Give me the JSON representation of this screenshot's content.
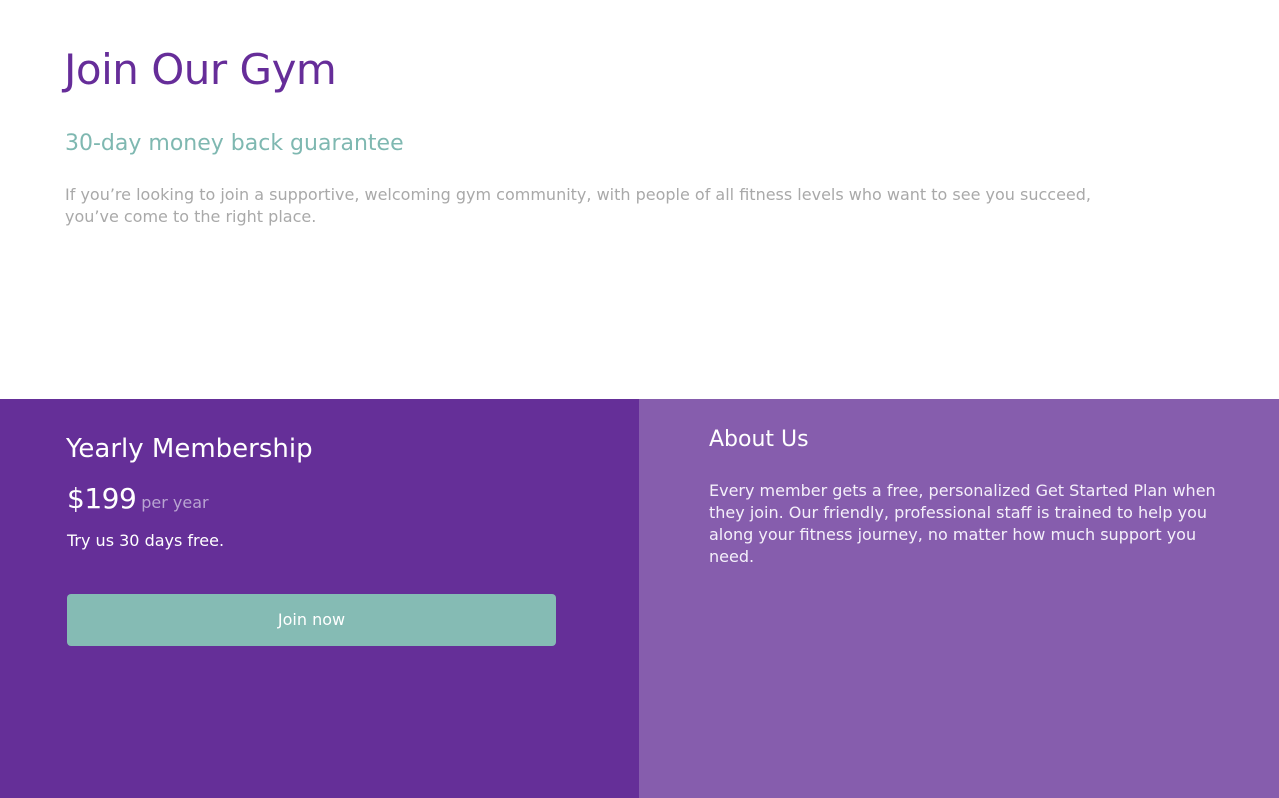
{
  "header": {
    "title": "Join Our Gym",
    "subtitle": "30-day money back guarantee",
    "intro": "If you’re looking to join a supportive, welcoming gym community, with people of all fitness levels who want to see you succeed, you’ve come to the right place."
  },
  "membership": {
    "title": "Yearly Membership",
    "price": "$199",
    "period": "per year",
    "trial": "Try us 30 days free.",
    "button_label": "Join now"
  },
  "about": {
    "title": "About Us",
    "text": "Every member gets a free, personalized Get Started Plan when they join. Our friendly, professional staff is trained to help you along your fitness journey, no matter how much support you need."
  },
  "colors": {
    "brand_purple": "#662d99",
    "secondary_purple": "#865dad",
    "accent_teal": "#85bbb4",
    "muted_text": "#a9a9a9"
  }
}
